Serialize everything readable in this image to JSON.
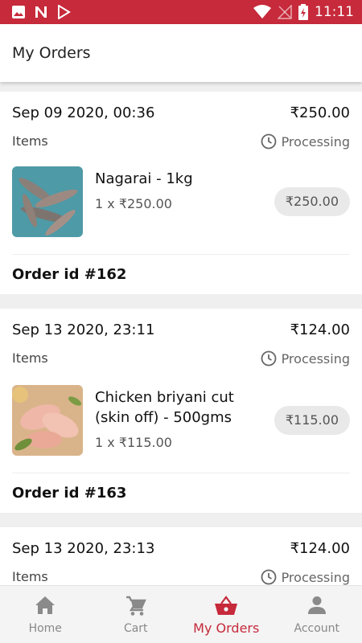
{
  "status_bar": {
    "time": "11:11",
    "bg_color": "#c62a3b"
  },
  "app_bar": {
    "title": "My Orders"
  },
  "orders": [
    {
      "date": "Sep 09 2020, 00:36",
      "total": "₹250.00",
      "items_label": "Items",
      "status": "Processing",
      "item": {
        "name": "Nagarai - 1kg",
        "qty": "1 x ₹250.00",
        "price": "₹250.00",
        "image": "fish-photo"
      },
      "order_id": "Order id #162"
    },
    {
      "date": "Sep 13 2020, 23:11",
      "total": "₹124.00",
      "items_label": "Items",
      "status": "Processing",
      "item": {
        "name_line1": "Chicken briyani cut",
        "name_line2": "(skin off) - 500gms",
        "qty": "1 x ₹115.00",
        "price": "₹115.00",
        "image": "chicken-photo"
      },
      "order_id": "Order id #163"
    },
    {
      "date": "Sep 13 2020, 23:13",
      "total": "₹124.00",
      "items_label": "Items",
      "status": "Processing"
    }
  ],
  "bottom_nav": {
    "items": [
      {
        "label": "Home",
        "icon": "home-icon"
      },
      {
        "label": "Cart",
        "icon": "cart-icon"
      },
      {
        "label": "My Orders",
        "icon": "basket-icon",
        "active": true
      },
      {
        "label": "Account",
        "icon": "person-icon"
      }
    ],
    "active_color": "#c62a3b"
  }
}
